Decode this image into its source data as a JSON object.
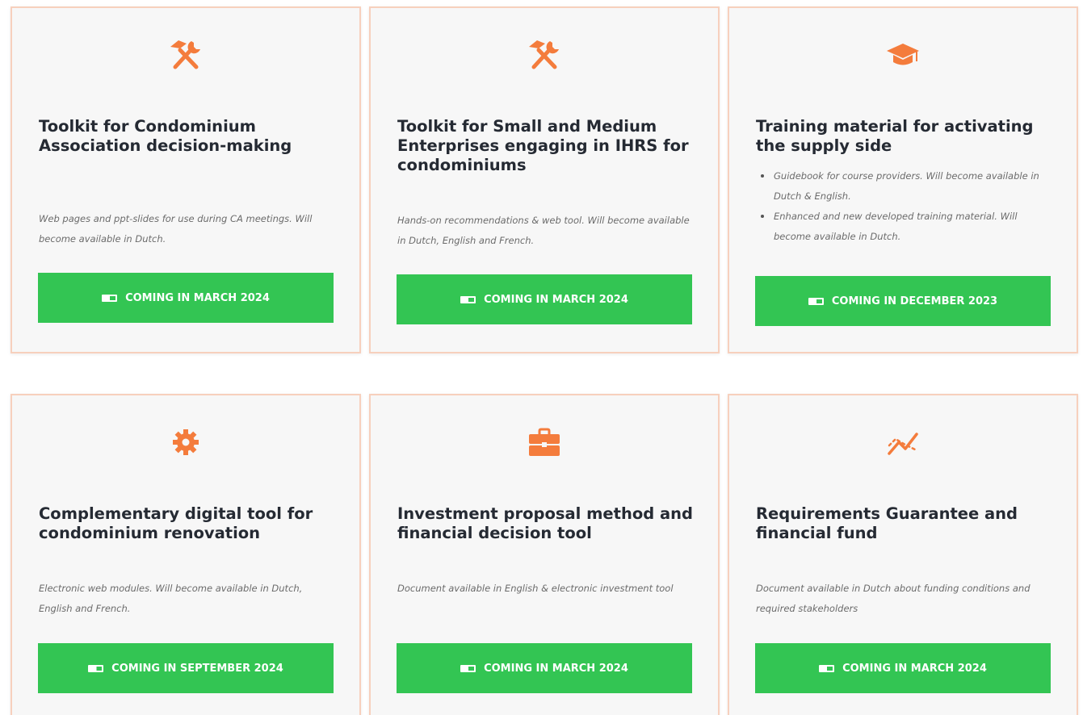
{
  "cards": [
    {
      "icon": "tools-icon",
      "title": "Toolkit for Condominium Association decision-making",
      "description": "Web pages and ppt-slides  for use during CA meetings. Will become available in Dutch.",
      "button_label": "COMING IN MARCH 2024"
    },
    {
      "icon": "tools-icon",
      "title": "Toolkit for Small and Medium Enterprises engaging in IHRS for condominiums",
      "description": "Hands-on recommendations & web tool. Will become available in Dutch, English and French.",
      "button_label": "COMING IN MARCH 2024"
    },
    {
      "icon": "graduation-cap-icon",
      "title": "Training material for activating the supply side",
      "bullets": [
        "Guidebook for course providers. Will become available in Dutch & English.",
        "Enhanced and new developed training material. Will become available in Dutch."
      ],
      "button_label": "COMING IN DECEMBER 2023"
    },
    {
      "icon": "gear-icon",
      "title": "Complementary digital tool for condominium renovation",
      "description": "Electronic web modules. Will become available in Dutch, English and French.",
      "button_label": "COMING IN SEPTEMBER 2024"
    },
    {
      "icon": "briefcase-icon",
      "title": "Investment proposal method and financial decision tool",
      "description": "Document available in English  &  electronic investment tool",
      "button_label": "COMING IN MARCH 2024"
    },
    {
      "icon": "line-chart-icon",
      "title": "Requirements Guarantee and financial fund",
      "description": "Document available in Dutch about funding conditions and required stakeholders",
      "button_label": "COMING IN MARCH 2024"
    }
  ],
  "colors": {
    "accent_orange": "#f47c3c",
    "button_green": "#33c553",
    "card_background": "#f7f7f7",
    "card_border": "#f7d0bd"
  }
}
